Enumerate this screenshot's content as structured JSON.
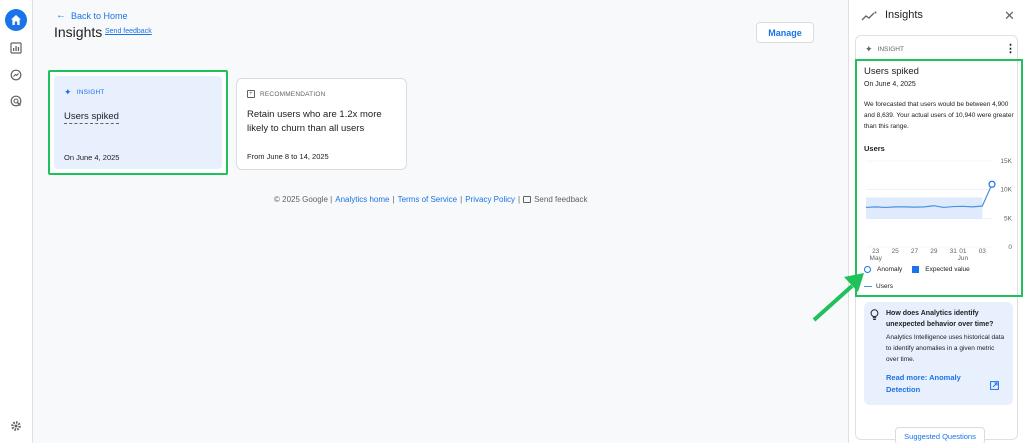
{
  "nav": {
    "back_label": "Back to Home",
    "page_title": "Insights",
    "send_feedback": "Send feedback",
    "manage_label": "Manage"
  },
  "cards": {
    "insight": {
      "kicker": "INSIGHT",
      "title": "Users spiked",
      "date": "On June 4, 2025"
    },
    "recommendation": {
      "kicker": "RECOMMENDATION",
      "title": "Retain users who are 1.2x more likely to churn than all users",
      "date": "From June 8 to 14, 2025"
    }
  },
  "footer": {
    "copyright": "© 2025 Google |",
    "analytics_home": "Analytics home",
    "sep1": "|",
    "terms": "Terms of Service",
    "sep2": "|",
    "privacy": "Privacy Policy",
    "sep3": "|",
    "send_feedback": "Send feedback"
  },
  "panel": {
    "title": "Insights",
    "card_kicker": "INSIGHT",
    "insight_title": "Users spiked",
    "insight_date": "On June 4, 2025",
    "insight_body": "We forecasted that users would be between 4,900 and 8,639. Your actual users of 10,940 were greater than this range.",
    "metric_label": "Users",
    "legend": {
      "anomaly": "Anomaly",
      "expected": "Expected value",
      "users": "Users"
    },
    "info": {
      "question": "How does Analytics identify unexpected behavior over time?",
      "answer": "Analytics Intelligence uses historical data to identify anomalies in a given metric over time.",
      "link": "Read more: Anomaly Detection"
    },
    "suggested_questions": "Suggested Questions"
  },
  "chart_data": {
    "type": "line",
    "ylabel": "",
    "y_ticks": [
      "15K",
      "10K",
      "5K",
      "0"
    ],
    "ylim": [
      0,
      15000
    ],
    "x_tick_labels": [
      "23",
      "25",
      "27",
      "29",
      "31",
      "01",
      "03"
    ],
    "x_sublabels": {
      "May": "23",
      "Jun": "01"
    },
    "series": [
      {
        "name": "Users",
        "x": [
          "May 22",
          "May 23",
          "May 24",
          "May 25",
          "May 26",
          "May 27",
          "May 28",
          "May 29",
          "May 30",
          "May 31",
          "Jun 1",
          "Jun 2",
          "Jun 3",
          "Jun 4"
        ],
        "values": [
          6900,
          7000,
          6900,
          7000,
          7000,
          6950,
          7000,
          7200,
          6900,
          7050,
          7100,
          7000,
          7150,
          10940
        ]
      }
    ],
    "expected_band": {
      "low": 4900,
      "high": 8639
    },
    "anomaly": {
      "x": "Jun 4",
      "value": 10940
    },
    "colors": {
      "users": "#4a90e2",
      "band": "#d2e3fc",
      "anomaly": "#1a73e8"
    }
  }
}
